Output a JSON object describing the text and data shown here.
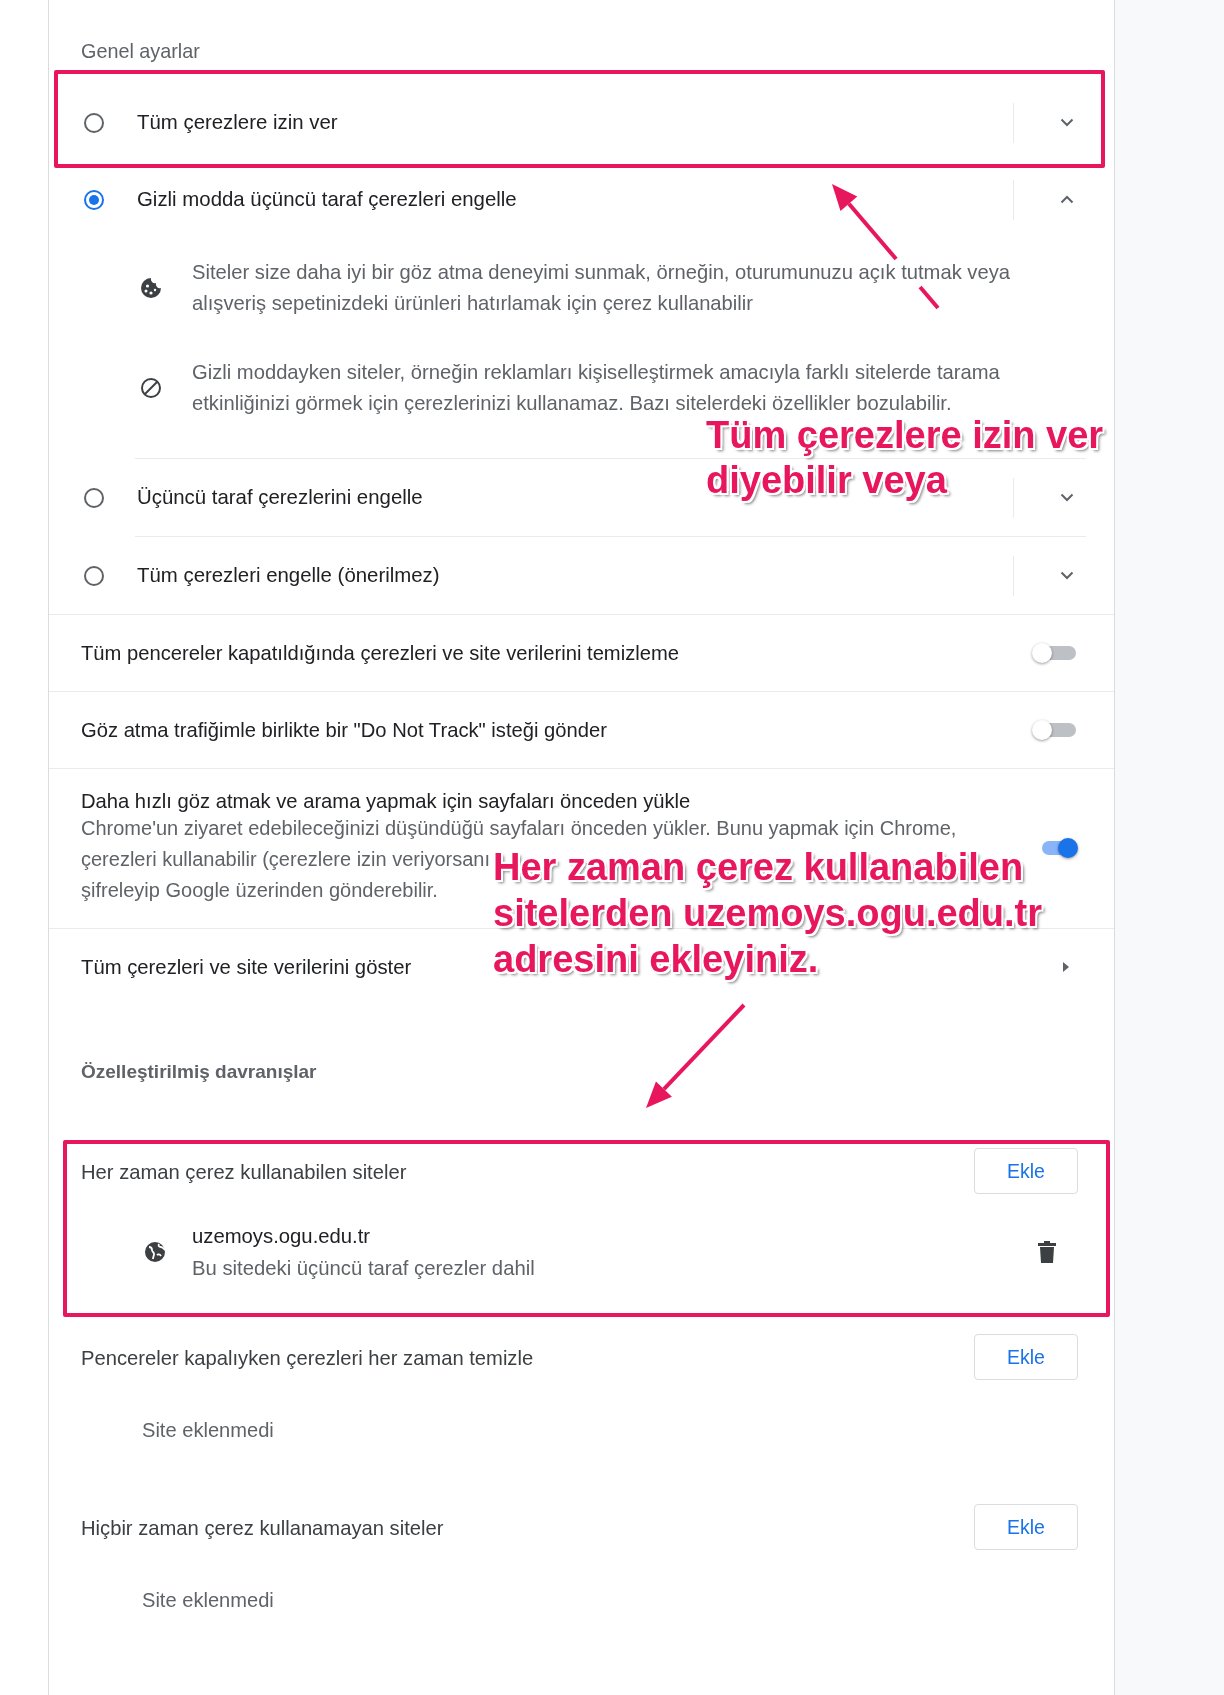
{
  "general_settings": {
    "heading": "Genel ayarlar",
    "options": [
      {
        "label": "Tüm çerezlere izin ver",
        "selected": false,
        "expanded": false
      },
      {
        "label": "Gizli modda üçüncü taraf çerezleri engelle",
        "selected": true,
        "expanded": true,
        "details": [
          {
            "kind": "cookie",
            "text": "Siteler size daha iyi bir göz atma deneyimi sunmak, örneğin, oturumunuzu açık tutmak veya alışveriş sepetinizdeki ürünleri hatırlamak için çerez kullanabilir"
          },
          {
            "kind": "blocked",
            "text": "Gizli moddayken siteler, örneğin reklamları kişiselleştirmek amacıyla farklı sitelerde tarama etkinliğinizi görmek için çerezlerinizi kullanamaz. Bazı sitelerdeki özellikler bozulabilir."
          }
        ]
      },
      {
        "label": "Üçüncü taraf çerezlerini engelle",
        "selected": false,
        "expanded": false
      },
      {
        "label": "Tüm çerezleri engelle (önerilmez)",
        "selected": false,
        "expanded": false
      }
    ]
  },
  "toggles": [
    {
      "label": "Tüm pencereler kapatıldığında çerezleri ve site verilerini temizleme",
      "on": false
    },
    {
      "label": "Göz atma trafiğimle birlikte bir \"Do Not Track\" isteği gönder",
      "on": false
    },
    {
      "label": "Daha hızlı göz atmak ve arama yapmak için sayfaları önceden yükle",
      "description_lines": [
        "Chrome'un ziyaret edebileceğinizi düşündüğü sayfaları önceden yükler. Bunu yapmak için Chrome,",
        "çerezleri kullanabilir (çerezlere izin veriyorsanı",
        "şifreleyip Google üzerinden gönderebilir."
      ],
      "on": true
    }
  ],
  "link_row": {
    "label": "Tüm çerezleri ve site verilerini göster"
  },
  "custom_behaviors": {
    "heading": "Özelleştirilmiş davranışlar",
    "lists": [
      {
        "title": "Her zaman çerez kullanabilen siteler",
        "button": "Ekle",
        "sites": [
          {
            "site": "uzemoys.ogu.edu.tr",
            "note": "Bu sitedeki üçüncü taraf çerezler dahil"
          }
        ]
      },
      {
        "title": "Pencereler kapalıyken çerezleri her zaman temizle",
        "button": "Ekle",
        "empty_text": "Site eklenmedi"
      },
      {
        "title": "Hiçbir zaman çerez kullanamayan siteler",
        "button": "Ekle",
        "empty_text": "Site eklenmedi"
      }
    ]
  },
  "annotations": [
    {
      "kind": "box"
    },
    {
      "kind": "arrow"
    },
    {
      "kind": "callout",
      "lines": [
        "Tüm çerezlere izin ver",
        "diyebilir veya"
      ]
    },
    {
      "kind": "callout",
      "lines": [
        "Her zaman çerez kullanabilen",
        "sitelerden uzemoys.ogu.edu.tr",
        "adresini ekleyiniz."
      ]
    },
    {
      "kind": "arrow"
    },
    {
      "kind": "box"
    }
  ]
}
